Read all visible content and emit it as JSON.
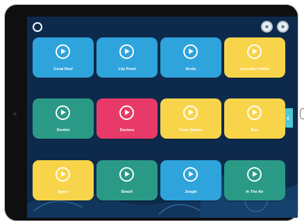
{
  "colors": {
    "background": "#0d2a4d",
    "blue": "#2fa3db",
    "yellow": "#f7d44a",
    "green": "#2a9a86",
    "red": "#e83a68",
    "side_tab": "#4ec9d3"
  },
  "icons": {
    "home": "circle-icon",
    "prev": "double-chevron-left-icon",
    "next": "double-chevron-right-icon",
    "play": "play-circle-icon",
    "side_tab": "chevron-left-icon"
  },
  "nav": {
    "prev_glyph": "«",
    "next_glyph": "»",
    "side_glyph": "‹"
  },
  "tiles": [
    {
      "label": "Coral Reef",
      "color": "#2fa3db"
    },
    {
      "label": "Lily Pond",
      "color": "#2fa3db"
    },
    {
      "label": "Arctic",
      "color": "#2fa3db"
    },
    {
      "label": "Lavender Fields",
      "color": "#f7d44a"
    },
    {
      "label": "Dentist",
      "color": "#2a9a86"
    },
    {
      "label": "Doctors",
      "color": "#e83a68"
    },
    {
      "label": "Train Station",
      "color": "#f7d44a"
    },
    {
      "label": "Bus",
      "color": "#f7d44a"
    },
    {
      "label": "Space",
      "color": "#f7d44a"
    },
    {
      "label": "Beach",
      "color": "#2a9a86"
    },
    {
      "label": "Jungle",
      "color": "#2fa3db"
    },
    {
      "label": "In The Air",
      "color": "#2a9a86"
    }
  ]
}
